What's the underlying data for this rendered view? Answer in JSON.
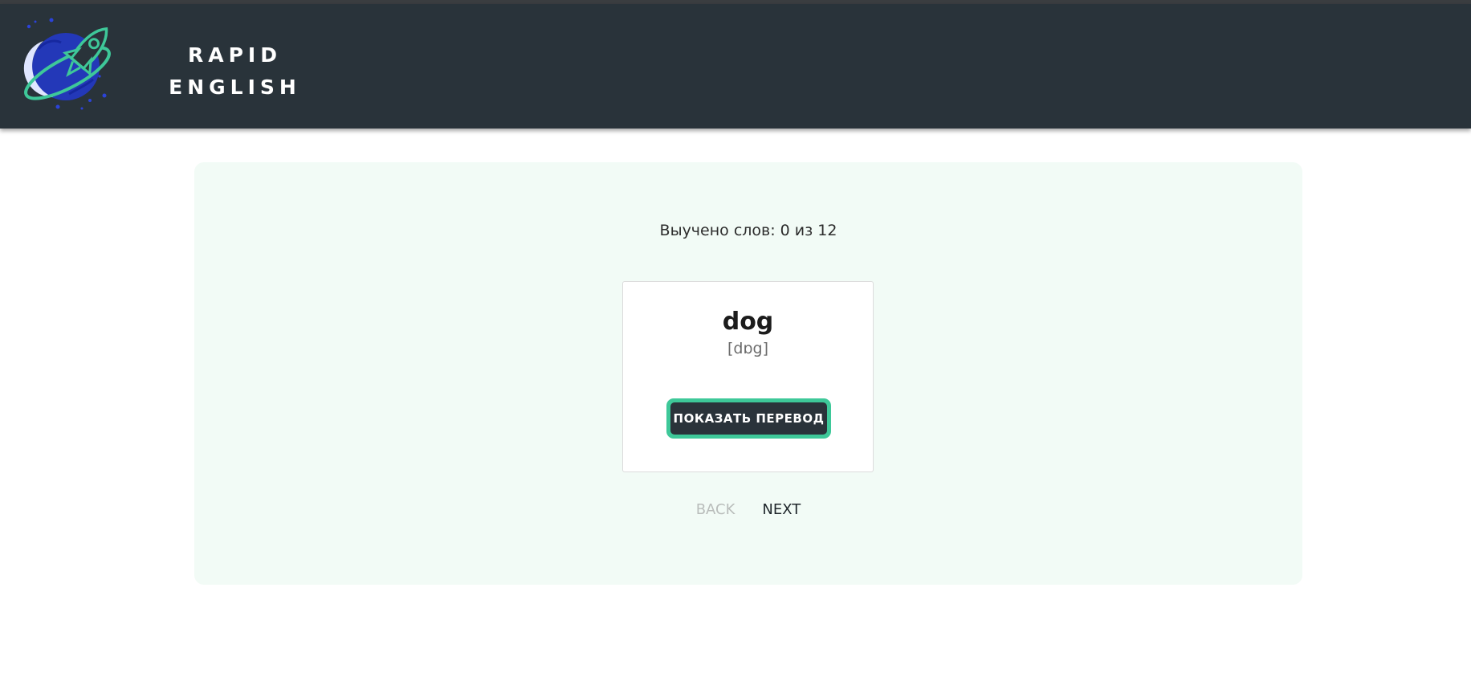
{
  "header": {
    "brand_line1": "RAPID",
    "brand_line2": "ENGLISH",
    "logo_icon": "rocket-globe-logo"
  },
  "progress": {
    "text": "Выучено слов: 0 из 12",
    "learned": 0,
    "total": 12
  },
  "card": {
    "word": "dog",
    "transcription": "[dɒg]",
    "show_translation_label": "ПОКАЗАТЬ ПЕРЕВОД"
  },
  "navigation": {
    "back_label": "BACK",
    "back_disabled": true,
    "next_label": "NEXT"
  },
  "colors": {
    "header_bg": "#29333a",
    "accent": "#3ec899",
    "panel_bg": "#f2fbf6",
    "logo_blue": "#2b43d8"
  }
}
